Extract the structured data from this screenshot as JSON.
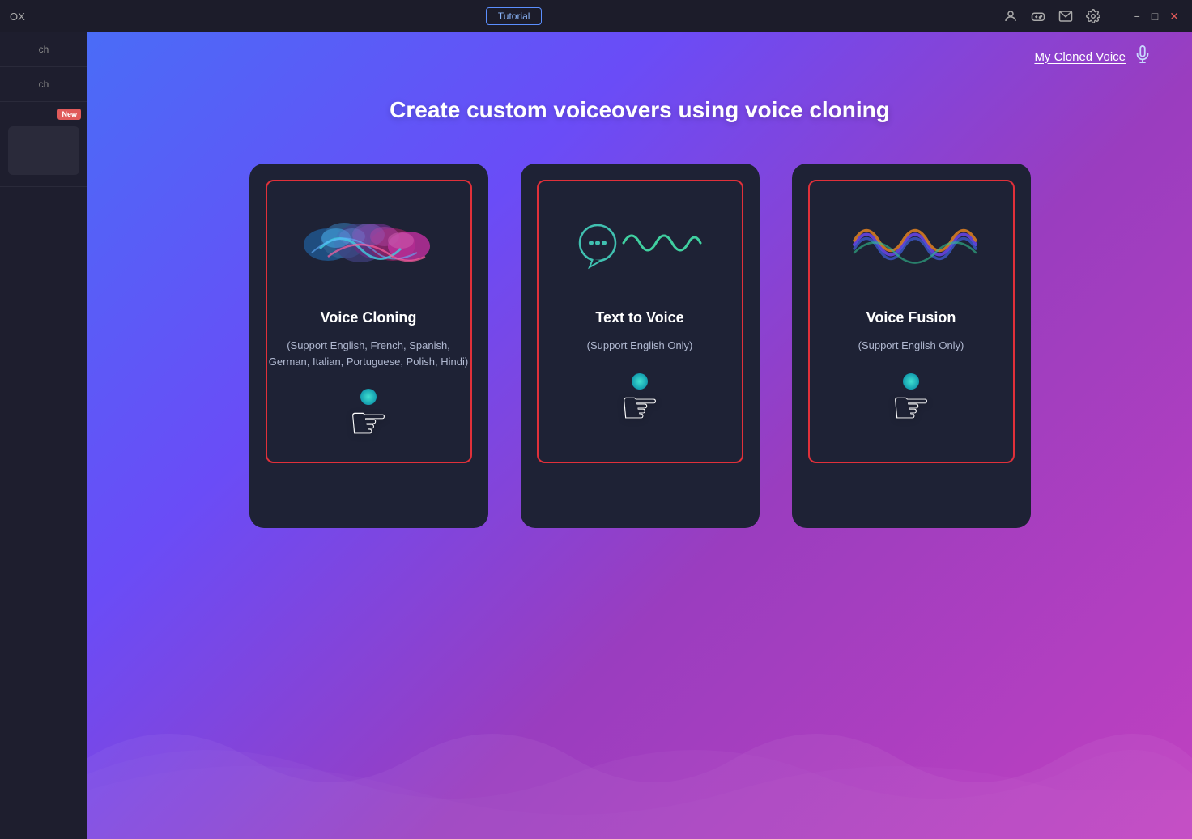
{
  "titlebar": {
    "app_name": "OX",
    "tutorial_label": "Tutorial",
    "icons": [
      "user",
      "gamepad",
      "mail",
      "settings"
    ],
    "window_controls": [
      "minimize",
      "maximize",
      "close"
    ]
  },
  "sidebar": {
    "items": [
      {
        "label": "ch",
        "badge": ""
      },
      {
        "label": "ch",
        "badge": ""
      },
      {
        "label": "New",
        "badge": "New"
      }
    ]
  },
  "header": {
    "cloned_voice_link": "My Cloned Voice"
  },
  "main": {
    "page_title": "Create custom voiceovers using voice cloning",
    "cards": [
      {
        "id": "voice-cloning",
        "title": "Voice Cloning",
        "subtitle": "(Support English, French, Spanish, German, Italian, Portuguese, Polish, Hindi)"
      },
      {
        "id": "text-to-voice",
        "title": "Text to Voice",
        "subtitle": "(Support English Only)"
      },
      {
        "id": "voice-fusion",
        "title": "Voice Fusion",
        "subtitle": "(Support English Only)"
      }
    ]
  }
}
